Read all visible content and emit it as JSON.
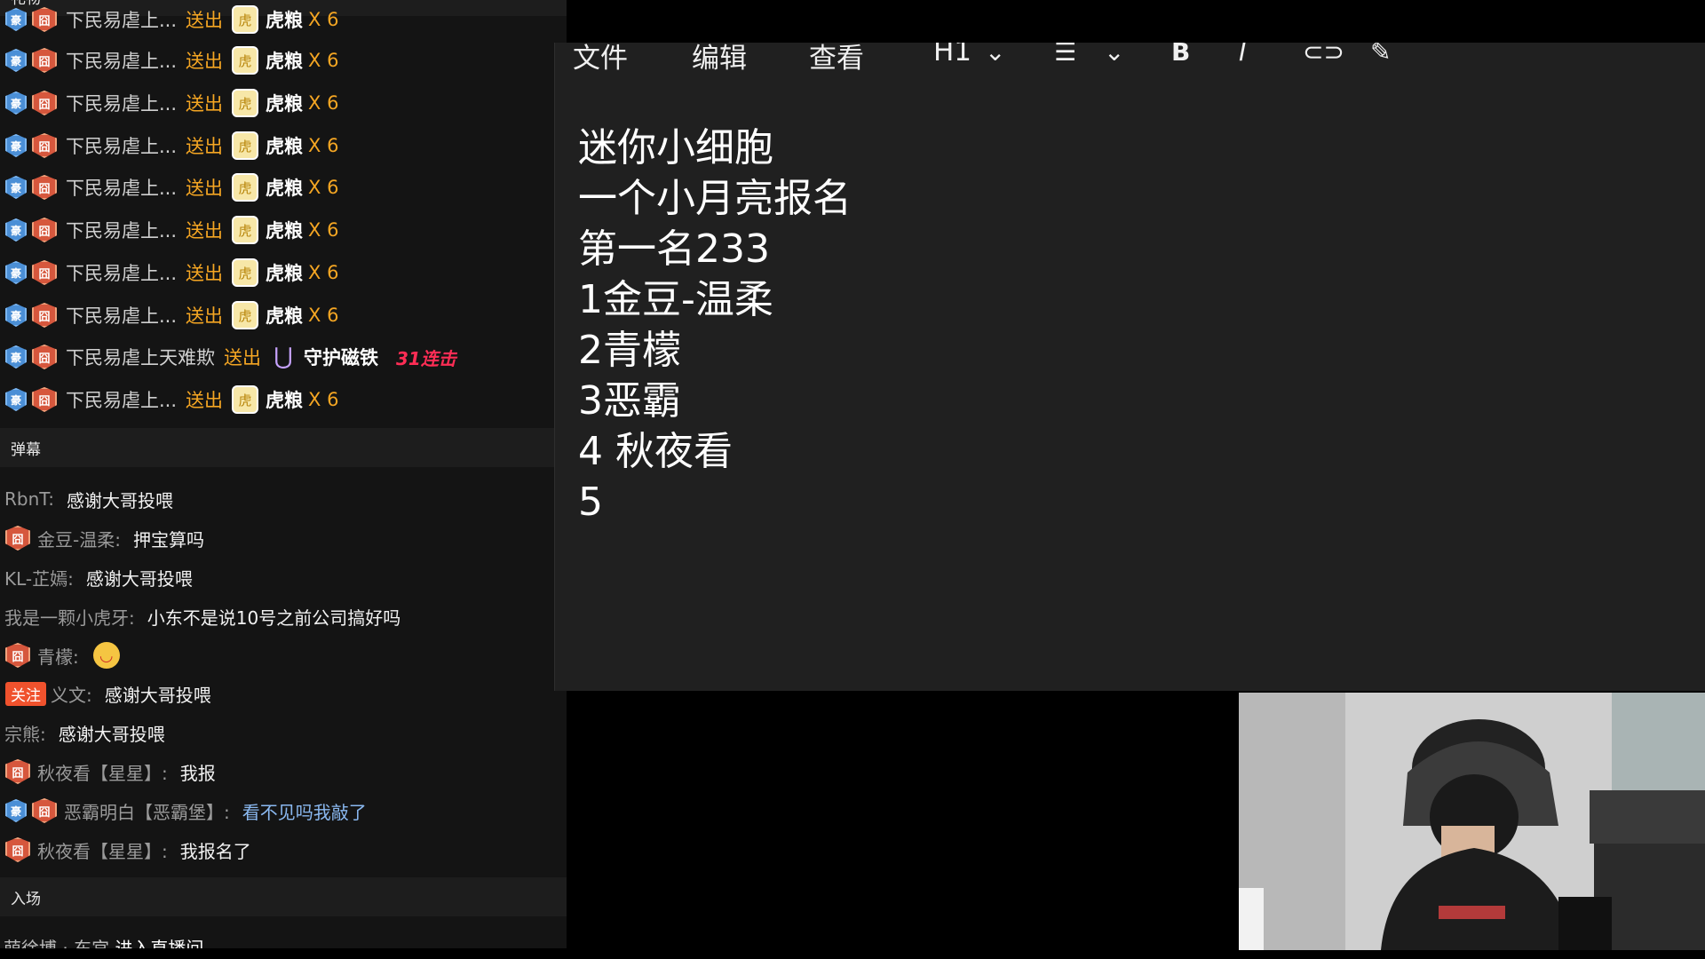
{
  "chat": {
    "gift_header": "礼物",
    "gift_rows": [
      {
        "user": "下民易虐上...",
        "verb": "送出",
        "gift": "虎粮",
        "count": "X 6"
      },
      {
        "user": "下民易虐上...",
        "verb": "送出",
        "gift": "虎粮",
        "count": "X 6"
      },
      {
        "user": "下民易虐上...",
        "verb": "送出",
        "gift": "虎粮",
        "count": "X 6"
      },
      {
        "user": "下民易虐上...",
        "verb": "送出",
        "gift": "虎粮",
        "count": "X 6"
      },
      {
        "user": "下民易虐上...",
        "verb": "送出",
        "gift": "虎粮",
        "count": "X 6"
      },
      {
        "user": "下民易虐上...",
        "verb": "送出",
        "gift": "虎粮",
        "count": "X 6"
      },
      {
        "user": "下民易虐上...",
        "verb": "送出",
        "gift": "虎粮",
        "count": "X 6"
      },
      {
        "user": "下民易虐上...",
        "verb": "送出",
        "gift": "虎粮",
        "count": "X 6"
      },
      {
        "user": "下民易虐上天难欺",
        "verb": "送出",
        "gift": "守护磁铁",
        "combo": "31连击"
      },
      {
        "user": "下民易虐上...",
        "verb": "送出",
        "gift": "虎粮",
        "count": "X 6"
      }
    ],
    "badge_vip": "豪",
    "badge_fan": "囧",
    "gift_icon": "虎",
    "danmu_header": "弹幕",
    "messages": [
      {
        "name": "RbnT:",
        "text": "感谢大哥投喂"
      },
      {
        "name": "金豆-温柔:",
        "text": "押宝算吗"
      },
      {
        "name": "KL-芷嫣:",
        "text": "感谢大哥投喂"
      },
      {
        "name": "我是一颗小虎牙:",
        "text": "小东不是说10号之前公司搞好吗"
      },
      {
        "name": "青檬:",
        "text": ""
      },
      {
        "name": "义文:",
        "text": "感谢大哥投喂",
        "tag": "关注"
      },
      {
        "name": "宗熊:",
        "text": "感谢大哥投喂"
      },
      {
        "name": "秋夜看【星星】:",
        "text": "我报"
      },
      {
        "name": "恶霸明白【恶霸堡】:",
        "text": "看不见吗我敲了"
      },
      {
        "name": "秋夜看【星星】:",
        "text": "我报名了"
      }
    ],
    "enter_header": "入场",
    "enter_user": "萌徐博 · 东宫",
    "enter_text": "进入直播间"
  },
  "editor": {
    "menu": [
      "文件",
      "编辑",
      "查看"
    ],
    "heading_select": "H1",
    "lines": [
      "迷你小细胞",
      "一个小月亮报名",
      "第一名233",
      "1金豆-温柔",
      "2青檬",
      "3恶霸",
      "4 秋夜看",
      "5"
    ]
  },
  "colors": {
    "panel_bg": "#141414",
    "editor_bg": "#202020",
    "gift_orange": "#f5a623",
    "combo_red": "#ff2d55",
    "chat_highlight_blue": "#8ab8f0"
  }
}
